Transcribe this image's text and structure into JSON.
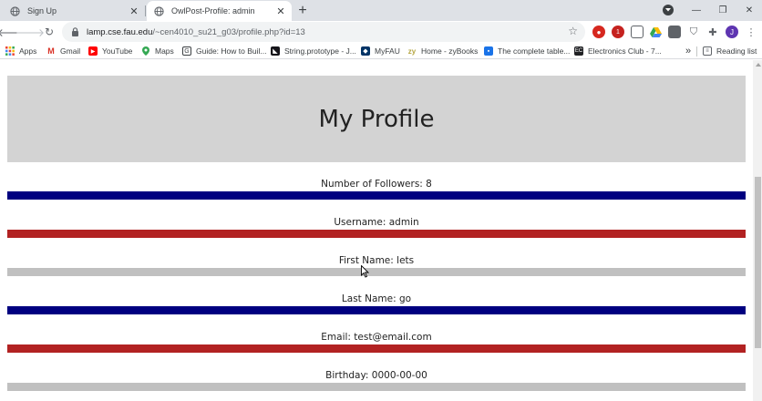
{
  "browser": {
    "tabs": [
      {
        "title": "Sign Up",
        "active": false
      },
      {
        "title": "OwlPost-Profile: admin",
        "active": true
      }
    ],
    "url": {
      "host": "lamp.cse.fau.edu",
      "path": "/~cen4010_su21_g03/profile.php?id=13"
    },
    "profile_initial": "J",
    "ext_badge": "1",
    "bookmarks": [
      {
        "label": "Apps",
        "icon": "apps-grid-icon",
        "color": "#5f6368"
      },
      {
        "label": "Gmail",
        "icon": "gmail-icon",
        "color": "#d93025"
      },
      {
        "label": "YouTube",
        "icon": "youtube-icon",
        "color": "#ff0000"
      },
      {
        "label": "Maps",
        "icon": "maps-pin-icon",
        "color": "#34a853"
      },
      {
        "label": "Guide: How to Buil...",
        "icon": "page-icon",
        "color": "#1a73e8"
      },
      {
        "label": "String.prototype - J...",
        "icon": "mdn-icon",
        "color": "#15141a"
      },
      {
        "label": "MyFAU",
        "icon": "owl-icon",
        "color": "#003366"
      },
      {
        "label": "Home - zyBooks",
        "icon": "zybooks-icon",
        "color": "#b5a642"
      },
      {
        "label": "The complete table...",
        "icon": "bookmark-blue-icon",
        "color": "#1a73e8"
      },
      {
        "label": "Electronics Club - 7...",
        "icon": "ec-icon",
        "color": "#202124"
      }
    ],
    "overflow_label": "»",
    "reading_list_label": "Reading list"
  },
  "page": {
    "title": "My Profile",
    "fields": [
      {
        "label": "Number of Followers: 8",
        "bar_color": "#000080"
      },
      {
        "label": "Username: admin",
        "bar_color": "#b22222"
      },
      {
        "label": "First Name: lets",
        "bar_color": "#c0c0c0"
      },
      {
        "label": "Last Name: go",
        "bar_color": "#000080"
      },
      {
        "label": "Email: test@email.com",
        "bar_color": "#b22222"
      },
      {
        "label": "Birthday: 0000-00-00",
        "bar_color": "#c0c0c0"
      }
    ]
  }
}
